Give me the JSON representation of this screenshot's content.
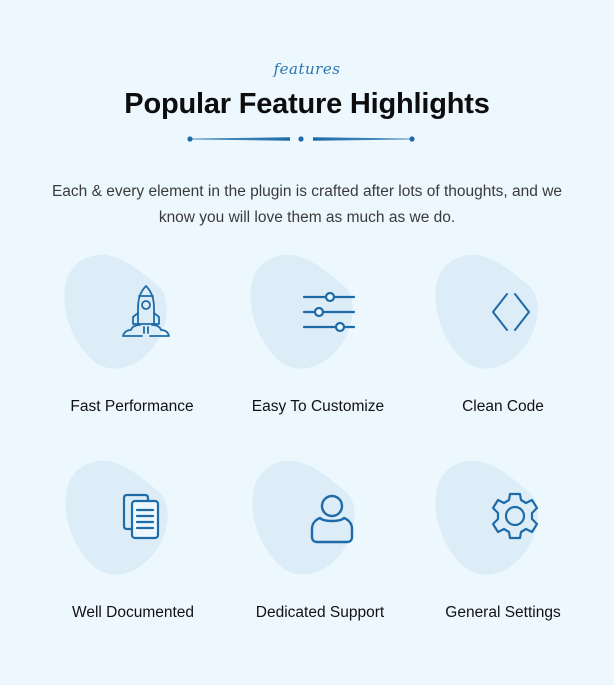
{
  "section": {
    "eyebrow": "features",
    "title": "Popular Feature Highlights",
    "subtitle": "Each & every element in the plugin is crafted after lots of thoughts, and we know you will love them as much as we do."
  },
  "colors": {
    "background": "#EDF8FE",
    "accent": "#1E6BA8",
    "blob": "#DCEDF8",
    "heading": "#0D0D0D",
    "body_text": "#3A3A3A"
  },
  "features": [
    {
      "label": "Fast Performance",
      "icon": "rocket-icon"
    },
    {
      "label": "Easy To Customize",
      "icon": "sliders-icon"
    },
    {
      "label": "Clean Code",
      "icon": "code-brackets-icon"
    },
    {
      "label": "Well Documented",
      "icon": "documents-icon"
    },
    {
      "label": "Dedicated Support",
      "icon": "user-icon"
    },
    {
      "label": "General Settings",
      "icon": "gear-icon"
    }
  ]
}
